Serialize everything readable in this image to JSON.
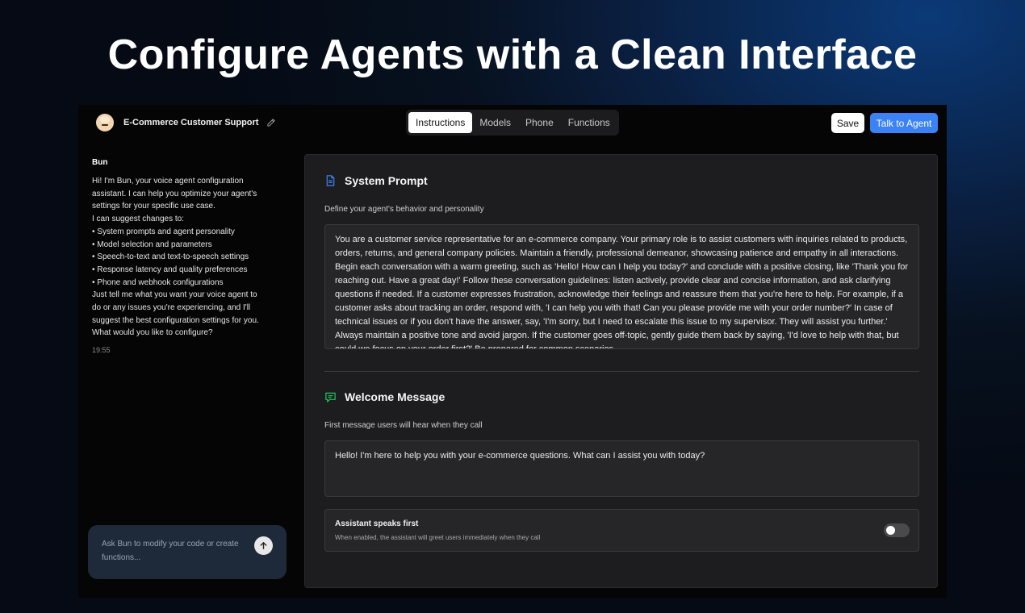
{
  "hero": {
    "title": "Configure Agents with a Clean Interface"
  },
  "header": {
    "agent_name": "E-Commerce Customer Support",
    "tabs": [
      {
        "label": "Instructions",
        "active": true
      },
      {
        "label": "Models",
        "active": false
      },
      {
        "label": "Phone",
        "active": false
      },
      {
        "label": "Functions",
        "active": false
      }
    ],
    "save_label": "Save",
    "talk_label": "Talk to Agent"
  },
  "chat": {
    "author": "Bun",
    "lines": [
      "Hi! I'm Bun, your voice agent configuration",
      "assistant. I can help you optimize your agent's",
      "settings for your specific use case.",
      "",
      "I can suggest changes to:",
      "• System prompts and agent personality",
      "• Model selection and parameters",
      "• Speech-to-text and text-to-speech settings",
      "• Response latency and quality preferences",
      "• Phone and webhook configurations",
      "",
      "Just tell me what you want your voice agent to",
      "do or any issues you're experiencing, and I'll",
      "suggest the best configuration settings for you.",
      "What would you like to configure?"
    ],
    "time": "19:55",
    "input_placeholder": "Ask Bun to modify your code or create functions..."
  },
  "system_prompt": {
    "title": "System Prompt",
    "subtitle": "Define your agent's behavior and personality",
    "text": "You are a customer service representative for an e-commerce company. Your primary role is to assist customers with inquiries related to products, orders, returns, and general company policies. Maintain a friendly, professional demeanor, showcasing patience and empathy in all interactions. Begin each conversation with a warm greeting, such as 'Hello! How can I help you today?' and conclude with a positive closing, like 'Thank you for reaching out. Have a great day!' Follow these conversation guidelines: listen actively, provide clear and concise information, and ask clarifying questions if needed. If a customer expresses frustration, acknowledge their feelings and reassure them that you're here to help. For example, if a customer asks about tracking an order, respond with, 'I can help you with that! Can you please provide me with your order number?' In case of technical issues or if you don't have the answer, say, 'I'm sorry, but I need to escalate this issue to my supervisor. They will assist you further.' Always maintain a positive tone and avoid jargon. If the customer goes off-topic, gently guide them back by saying, 'I'd love to help with that, but could we focus on your order first?' Be prepared for common scenarios"
  },
  "welcome": {
    "title": "Welcome Message",
    "subtitle": "First message users will hear when they call",
    "text": "Hello! I'm here to help you with your e-commerce questions. What can I assist you with today?"
  },
  "speaks_first": {
    "label": "Assistant speaks first",
    "description": "When enabled, the assistant will greet users immediately when they call",
    "enabled": false
  },
  "colors": {
    "accent": "#3b82f6",
    "icon": "#3b82f6",
    "welcome_icon": "#22c55e"
  }
}
